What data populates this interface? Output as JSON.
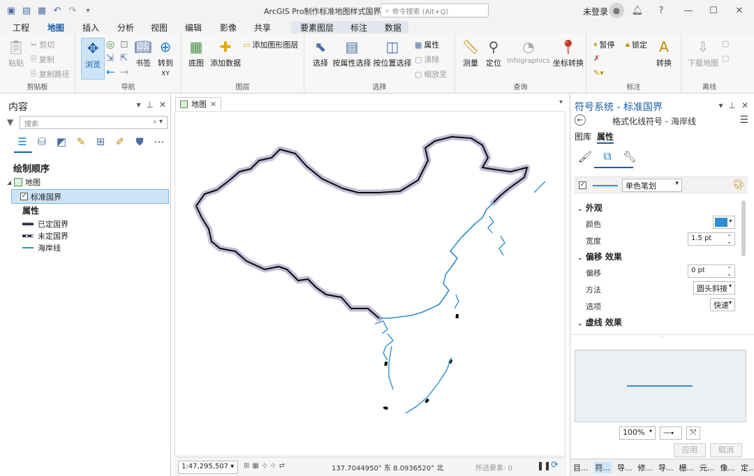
{
  "titlebar": {
    "window_title": "ArcGIS Pro制作标准地图样式国界",
    "command_search_placeholder": "命令搜索 (Alt+Q)",
    "user": "未登录",
    "help": "?"
  },
  "ribbon_tabs": [
    "工程",
    "地图",
    "插入",
    "分析",
    "视图",
    "编辑",
    "影像",
    "共享",
    "要素图层",
    "标注",
    "数据"
  ],
  "ribbon": {
    "clipboard": {
      "paste": "粘贴",
      "cut": "剪切",
      "copy": "复制",
      "copy_path": "复制路径",
      "group": "剪贴板"
    },
    "navigate": {
      "explore": "浏览",
      "bookmarks": "书签",
      "goto_xy": "转到",
      "goto_xy_sub": "XY",
      "group": "导航"
    },
    "layer": {
      "basemap": "底图",
      "add_data": "添加数据",
      "add_graphics": "添加图形图层",
      "group": "图层"
    },
    "selection": {
      "select": "选择",
      "select_by_attr": "按属性选择",
      "select_by_loc": "按位置选择",
      "attributes": "属性",
      "clear": "清除",
      "zoom_to": "缩放至",
      "group": "选择"
    },
    "inquiry": {
      "measure": "测量",
      "locate": "定位",
      "infographics": "Infographics",
      "convert_coords": "坐标转换",
      "group": "查询"
    },
    "labeling": {
      "pause": "暂停",
      "lock": "锁定",
      "convert": "转换",
      "group": "标注"
    },
    "offline": {
      "download_map": "下载地图",
      "group": "离线"
    }
  },
  "contents": {
    "title": "内容",
    "search_placeholder": "搜索",
    "draw_order": "绘制顺序",
    "map_node": "地图",
    "layer_name": "标准国界",
    "attr_title": "属性",
    "legend": [
      {
        "label": "已定国界",
        "color": "#000000",
        "halo": "#b9b2d0"
      },
      {
        "label": "未定国界",
        "color": "#000000",
        "halo": "#b9b2d0"
      },
      {
        "label": "海岸线",
        "color": "#2d8fd0",
        "halo": ""
      }
    ]
  },
  "mapview": {
    "tab_label": "地图",
    "scale": "1:47,295,507",
    "coordinates": "137.7044950° 东 8.0936520° 北",
    "selected_features": "所选要素: 0",
    "border_color": "#0a0a0a",
    "halo_color": "#b9b2d0",
    "coast_color": "#2d8fd0"
  },
  "symbology": {
    "title": "符号系统 - 标准国界",
    "subtitle": "格式化线符号 - 海岸线",
    "tab_gallery": "图库",
    "tab_properties": "属性",
    "stroke_type": "单色笔划",
    "section_appearance": "外观",
    "color_label": "颜色",
    "color_value": "#2d8fd0",
    "width_label": "宽度",
    "width_value": "1.5 pt",
    "section_offset": "偏移 效果",
    "offset_label": "偏移",
    "offset_value": "0 pt",
    "method_label": "方法",
    "method_value": "圆头斜接",
    "option_label": "选项",
    "option_value": "快速",
    "section_dash": "虚线 效果",
    "zoom": "100%",
    "apply": "应用",
    "cancel": "取消",
    "bottom_tabs": [
      "目...",
      "符...",
      "导...",
      "修...",
      "导...",
      "栅...",
      "元...",
      "像...",
      "定..."
    ]
  }
}
